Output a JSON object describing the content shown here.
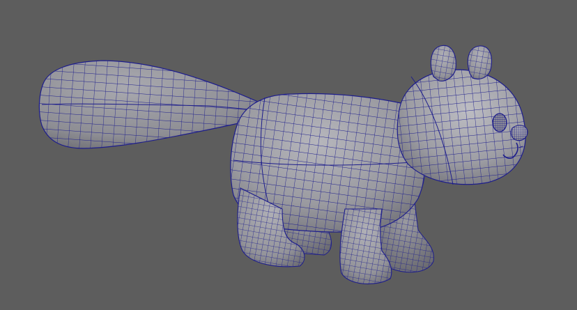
{
  "viewport": {
    "background_color": "#5d5d5d",
    "display_mode": "wireframe-on-shaded"
  },
  "model": {
    "subject": "squirrel",
    "shading_color": "#9c9ca2",
    "wireframe_color": "#1d1d8c",
    "parts": [
      "tail",
      "body",
      "head",
      "ear-left",
      "ear-right",
      "eye",
      "nose",
      "mouth",
      "front-leg-near",
      "front-leg-far",
      "hind-leg-near",
      "hind-leg-far"
    ]
  }
}
